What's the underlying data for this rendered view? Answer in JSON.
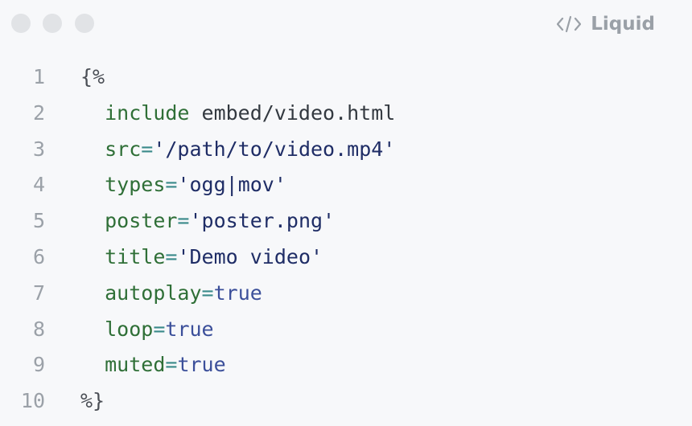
{
  "window": {
    "language_label": "Liquid",
    "language_icon": "code-icon"
  },
  "colors": {
    "background": "#f7f8fa",
    "traffic_light": "#e1e3e6",
    "line_number": "#9ba1a8",
    "keyword": "#2f6f37",
    "string": "#1f2d66",
    "boolean": "#3b4f9a",
    "plain": "#333940"
  },
  "code": {
    "lines": [
      {
        "number": "1",
        "indent": "",
        "tokens": [
          {
            "t": "{%",
            "k": "punct"
          }
        ]
      },
      {
        "number": "2",
        "indent": "  ",
        "tokens": [
          {
            "t": "include",
            "k": "kw"
          },
          {
            "t": " embed/video.html",
            "k": "plain"
          }
        ]
      },
      {
        "number": "3",
        "indent": "  ",
        "tokens": [
          {
            "t": "src",
            "k": "attr"
          },
          {
            "t": "=",
            "k": "op"
          },
          {
            "t": "'/path/to/video.mp4'",
            "k": "str"
          }
        ]
      },
      {
        "number": "4",
        "indent": "  ",
        "tokens": [
          {
            "t": "types",
            "k": "attr"
          },
          {
            "t": "=",
            "k": "op"
          },
          {
            "t": "'ogg|mov'",
            "k": "str"
          }
        ]
      },
      {
        "number": "5",
        "indent": "  ",
        "tokens": [
          {
            "t": "poster",
            "k": "attr"
          },
          {
            "t": "=",
            "k": "op"
          },
          {
            "t": "'poster.png'",
            "k": "str"
          }
        ]
      },
      {
        "number": "6",
        "indent": "  ",
        "tokens": [
          {
            "t": "title",
            "k": "attr"
          },
          {
            "t": "=",
            "k": "op"
          },
          {
            "t": "'Demo video'",
            "k": "str"
          }
        ]
      },
      {
        "number": "7",
        "indent": "  ",
        "tokens": [
          {
            "t": "autoplay",
            "k": "attr"
          },
          {
            "t": "=",
            "k": "op"
          },
          {
            "t": "true",
            "k": "bool"
          }
        ]
      },
      {
        "number": "8",
        "indent": "  ",
        "tokens": [
          {
            "t": "loop",
            "k": "attr"
          },
          {
            "t": "=",
            "k": "op"
          },
          {
            "t": "true",
            "k": "bool"
          }
        ]
      },
      {
        "number": "9",
        "indent": "  ",
        "tokens": [
          {
            "t": "muted",
            "k": "attr"
          },
          {
            "t": "=",
            "k": "op"
          },
          {
            "t": "true",
            "k": "bool"
          }
        ]
      },
      {
        "number": "10",
        "indent": "",
        "tokens": [
          {
            "t": "%}",
            "k": "punct"
          }
        ]
      }
    ]
  }
}
